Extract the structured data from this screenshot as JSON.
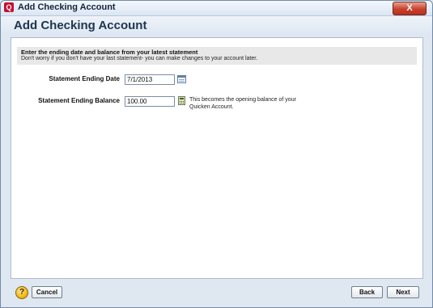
{
  "window": {
    "app_icon_letter": "Q",
    "title": "Add Checking Account",
    "close_label": "X"
  },
  "page": {
    "heading": "Add Checking Account"
  },
  "instructions": {
    "heading": "Enter the ending date and balance from your latest statement",
    "subtext": "Don't worry if you don't have your last statement- you can make changes to your account later."
  },
  "form": {
    "ending_date": {
      "label": "Statement Ending Date",
      "value": "7/1/2013",
      "icon": "calendar-icon"
    },
    "ending_balance": {
      "label": "Statement Ending Balance",
      "value": "100.00",
      "icon": "calculator-icon",
      "note": "This becomes the opening balance of your Quicken Account."
    }
  },
  "footer": {
    "help_icon_glyph": "?",
    "cancel_label": "Cancel",
    "back_label": "Back",
    "next_label": "Next"
  }
}
